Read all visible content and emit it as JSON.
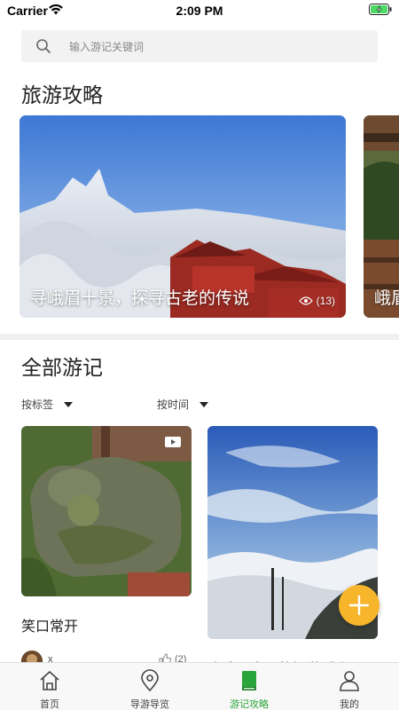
{
  "status_bar": {
    "carrier": "Carrier",
    "time": "2:09 PM"
  },
  "search": {
    "placeholder": "输入游记关键词"
  },
  "travel_section": {
    "title": "旅游攻略",
    "cards": [
      {
        "caption": "寻峨眉十景，探寻古老的传说",
        "views": "(13)"
      },
      {
        "caption": "峨眉"
      }
    ]
  },
  "notes_section": {
    "title": "全部游记",
    "filters": {
      "tag_label": "按标签",
      "time_label": "按时间"
    },
    "notes": [
      {
        "title": "笑口常开",
        "author": "x",
        "likes": "(2)"
      },
      {
        "title": "这才是真正的智游乐山"
      }
    ]
  },
  "tabbar": {
    "items": [
      {
        "label": "首页",
        "icon": "home-icon"
      },
      {
        "label": "导游导览",
        "icon": "location-icon"
      },
      {
        "label": "游记攻略",
        "icon": "book-icon",
        "active": true
      },
      {
        "label": "我的",
        "icon": "user-icon"
      }
    ]
  },
  "colors": {
    "accent": "#2aa53a",
    "fab": "#f6b52b"
  }
}
